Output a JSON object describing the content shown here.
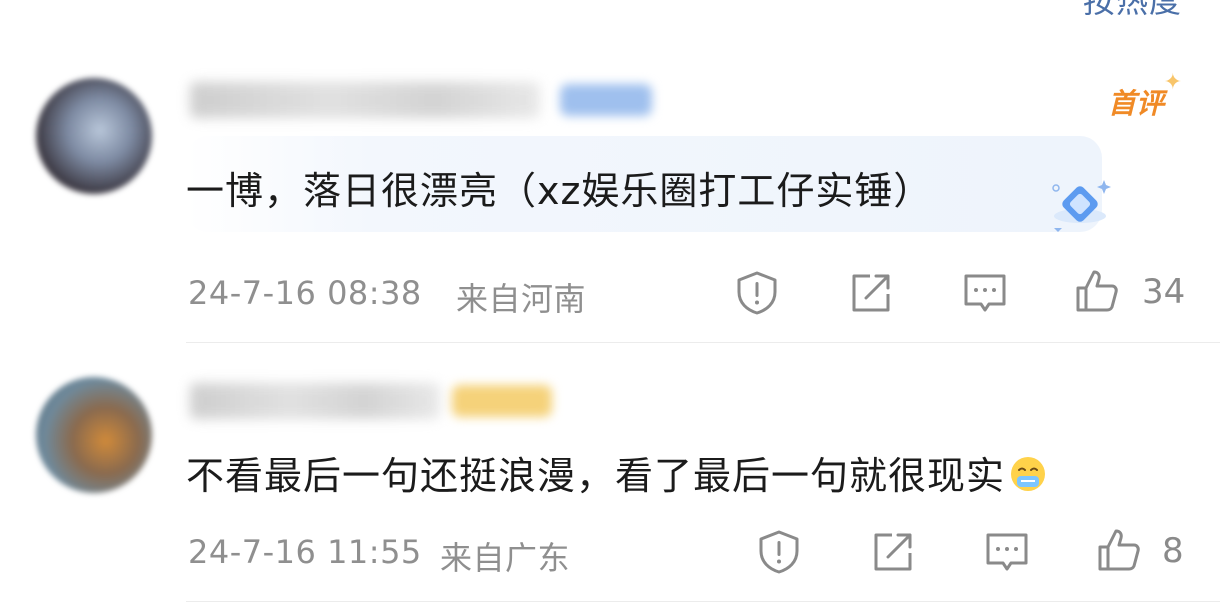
{
  "header": {
    "sort_label": "按热度"
  },
  "comments": [
    {
      "text": "一博，落日很漂亮（xz娱乐圈打工仔实锤）",
      "badge": "首评",
      "time": "24-7-16 08:38",
      "location": "来自河南",
      "likes": "34"
    },
    {
      "text": "不看最后一句还挺浪漫，看了最后一句就很现实",
      "time": "24-7-16 11:55",
      "location": "来自广东",
      "likes": "8"
    }
  ],
  "icons": [
    "report-icon",
    "share-icon",
    "reply-icon",
    "like-icon",
    "gem-icon",
    "emoji-icon"
  ],
  "colors": {
    "accent": "#f08a26",
    "link": "#4a6fa8",
    "meta": "#8f8f8f"
  }
}
